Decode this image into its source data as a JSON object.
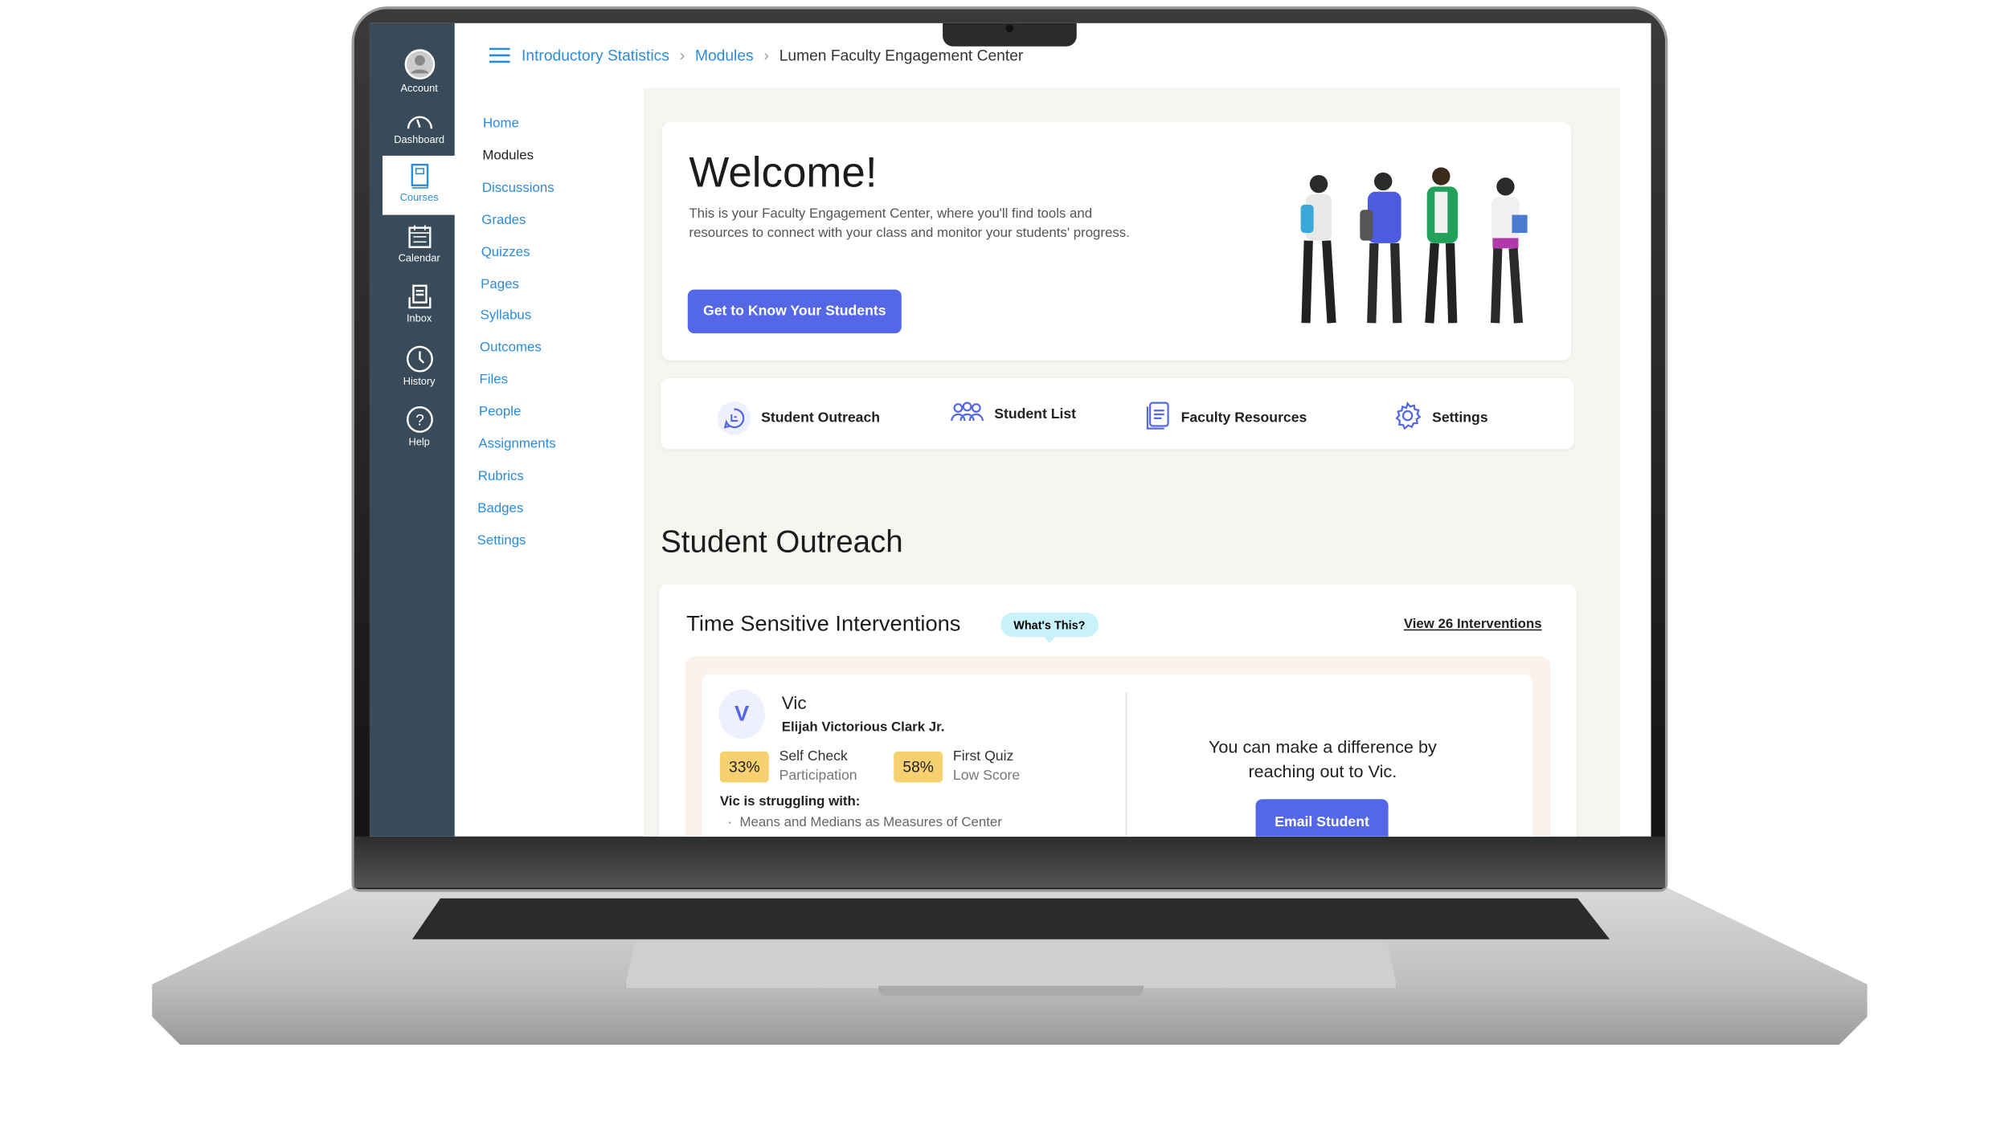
{
  "global_nav": [
    {
      "label": "Account",
      "icon": "account-icon"
    },
    {
      "label": "Dashboard",
      "icon": "dashboard-icon"
    },
    {
      "label": "Courses",
      "icon": "courses-icon",
      "active": true
    },
    {
      "label": "Calendar",
      "icon": "calendar-icon"
    },
    {
      "label": "Inbox",
      "icon": "inbox-icon"
    },
    {
      "label": "History",
      "icon": "history-icon"
    },
    {
      "label": "Help",
      "icon": "help-icon"
    }
  ],
  "breadcrumb": [
    "Introductory Statistics",
    "Modules",
    "Lumen Faculty Engagement Center"
  ],
  "course_nav": [
    "Home",
    "Modules",
    "Discussions",
    "Grades",
    "Quizzes",
    "Pages",
    "Syllabus",
    "Outcomes",
    "Files",
    "People",
    "Assignments",
    "Rubrics",
    "Badges",
    "Settings"
  ],
  "course_nav_current": "Modules",
  "welcome": {
    "title": "Welcome!",
    "body": "This is your Faculty Engagement Center, where you'll find tools and resources to connect with your class and monitor your students' progress.",
    "button": "Get to Know Your Students"
  },
  "tabs": [
    {
      "label": "Student Outreach",
      "icon": "chat-icon"
    },
    {
      "label": "Student List",
      "icon": "people-icon"
    },
    {
      "label": "Faculty Resources",
      "icon": "document-icon"
    },
    {
      "label": "Settings",
      "icon": "gear-icon"
    }
  ],
  "section_title": "Student Outreach",
  "interventions": {
    "title": "Time Sensitive Interventions",
    "badge": "What's This?",
    "view_link": "View 26 Interventions",
    "student": {
      "initial": "V",
      "nickname": "Vic",
      "full_name": "Elijah Victorious Clark Jr.",
      "metrics": [
        {
          "value": "33%",
          "line1": "Self Check",
          "line2": "Participation"
        },
        {
          "value": "58%",
          "line1": "First Quiz",
          "line2": "Low Score"
        }
      ],
      "struggling_label": "Vic is struggling with:",
      "struggling": [
        "Means and Medians as Measures of Center"
      ]
    },
    "cta_text": "You can make a difference by reaching out to Vic.",
    "cta_button": "Email Student"
  },
  "colors": {
    "accent": "#5468e7",
    "link": "#2d8bd8",
    "nav_bg": "#394b58",
    "metric": "#f7d070",
    "badge": "#c9f3fa"
  }
}
